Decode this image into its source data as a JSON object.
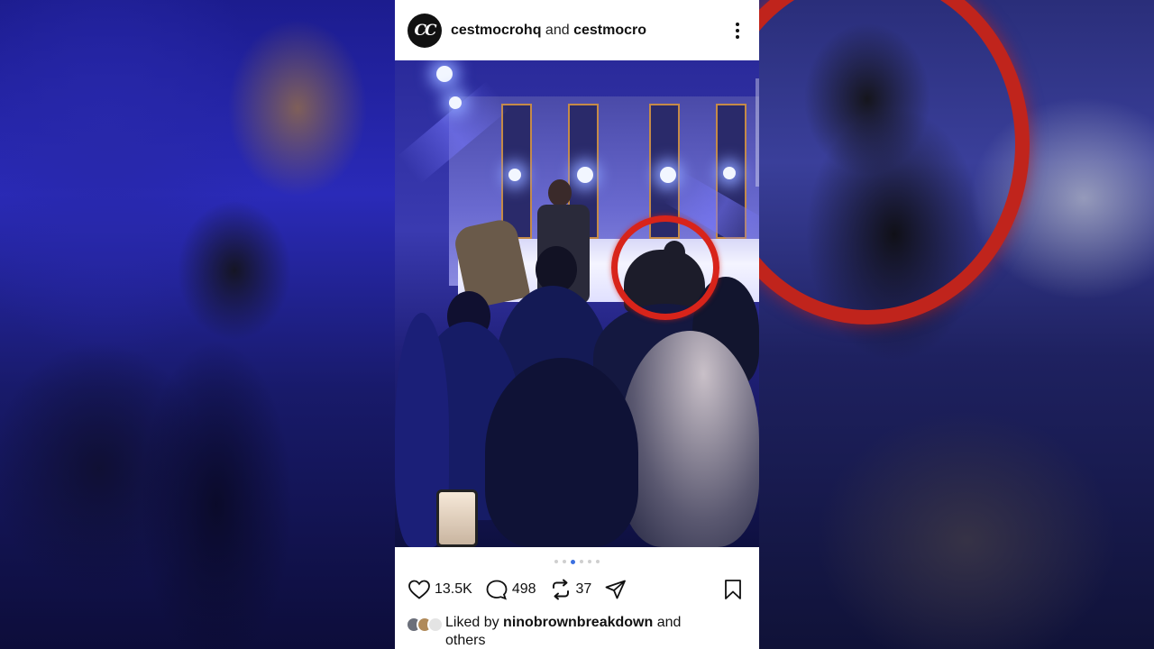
{
  "post": {
    "author_primary": "cestmocrohq",
    "joiner": "and",
    "author_secondary": "cestmocro",
    "avatar_text": "CC",
    "carousel": {
      "count": 6,
      "active_index": 2
    },
    "actions": {
      "likes": "13.5K",
      "comments": "498",
      "reposts": "37"
    },
    "liked_by": {
      "prefix": "Liked by",
      "user": "ninobrownbreakdown",
      "suffix": "and",
      "others": "others"
    }
  },
  "colors": {
    "highlight_ring": "#d8241a",
    "active_dot": "#3b6fe0",
    "stage_light": "#6a6ad0"
  },
  "icons": [
    "more-vertical-icon",
    "heart-icon",
    "comment-icon",
    "repost-icon",
    "share-icon",
    "bookmark-icon"
  ]
}
